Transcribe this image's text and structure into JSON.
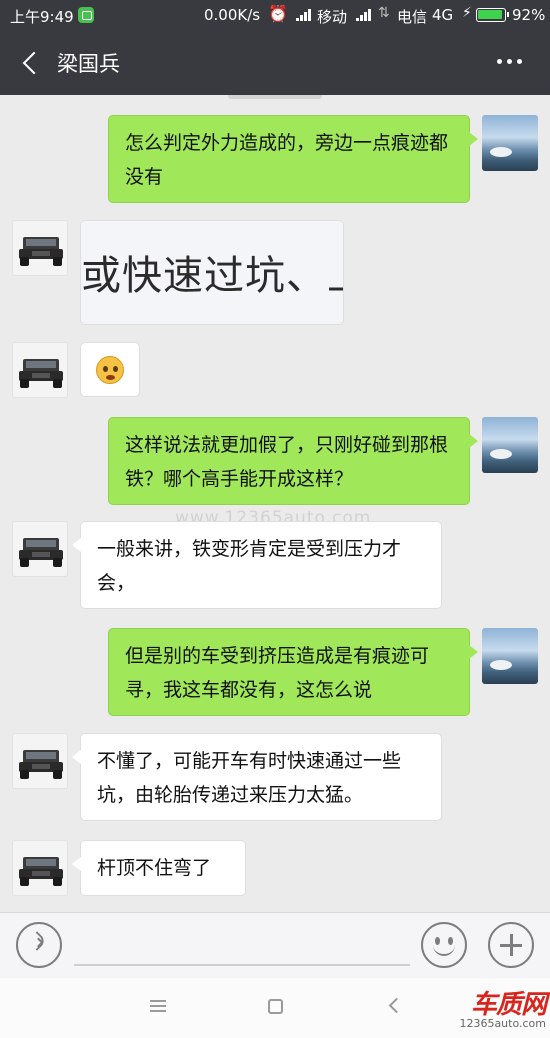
{
  "status_bar": {
    "time": "上午9:49",
    "speed": "0.00K/s",
    "carrier1": "移动",
    "carrier2": "电信",
    "network": "4G",
    "battery": "92%",
    "battery_level": 0.92
  },
  "header": {
    "title": "梁国兵"
  },
  "messages": [
    {
      "sender": "me",
      "text": "怎么判定外力造成的，旁边一点痕迹都没有"
    },
    {
      "sender": "other",
      "type": "image",
      "text": "或快速过坑、上下"
    },
    {
      "sender": "other",
      "type": "emoji",
      "icon": "confused-face-emoji"
    },
    {
      "sender": "me",
      "text": "这样说法就更加假了，只刚好碰到那根铁？哪个高手能开成这样？"
    },
    {
      "sender": "other",
      "text": "一般来讲，铁变形肯定是受到压力才会，"
    },
    {
      "sender": "me",
      "text": "但是别的车受到挤压造成是有痕迹可寻，我这车都没有，这怎么说"
    },
    {
      "sender": "other",
      "text": "不懂了，可能开车有时快速通过一些坑，由轮胎传递过来压力太猛。"
    },
    {
      "sender": "other",
      "text": "杆顶不住弯了"
    }
  ],
  "watermark": "www.12365auto.com",
  "brand": {
    "logo": "车质网",
    "url": "12365auto.com"
  },
  "colors": {
    "header": "#393a3f",
    "my_bubble": "#a0e75a",
    "their_bubble": "#ffffff",
    "chat_bg": "#ebebeb"
  },
  "icons": [
    "back-icon",
    "more-icon",
    "voice-icon",
    "emoji-icon",
    "plus-icon",
    "menu-icon",
    "home-icon",
    "nav-back-icon"
  ]
}
